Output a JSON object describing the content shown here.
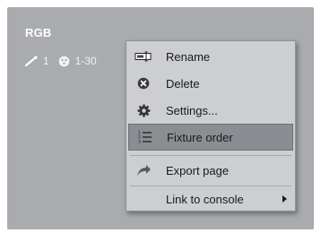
{
  "panel": {
    "title": "RGB",
    "info_count": "1",
    "info_range": "1-30"
  },
  "menu": {
    "items": [
      {
        "label": "Rename",
        "icon": "rename-icon"
      },
      {
        "label": "Delete",
        "icon": "delete-icon"
      },
      {
        "label": "Settings...",
        "icon": "settings-icon"
      },
      {
        "label": "Fixture order",
        "icon": "fixture-order-icon",
        "active": true
      },
      {
        "label": "Export page",
        "icon": "export-page-icon"
      },
      {
        "label": "Link to console",
        "icon": "",
        "submenu": true
      }
    ]
  },
  "colors": {
    "panel_bg": "#a9abae",
    "menu_bg": "#ccced1",
    "highlight": "#8a8e93"
  }
}
